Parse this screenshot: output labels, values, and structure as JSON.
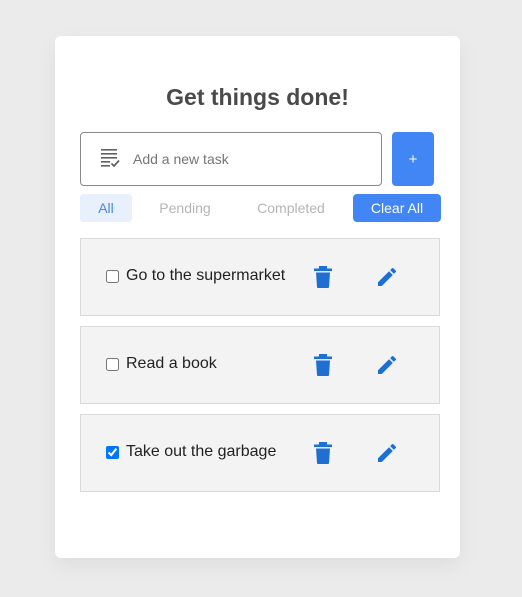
{
  "app": {
    "title": "Get things done!"
  },
  "input": {
    "placeholder": "Add a new task",
    "value": "",
    "icon": "task-list-icon",
    "add_label": "+"
  },
  "filters": {
    "all": "All",
    "pending": "Pending",
    "completed": "Completed",
    "active": "All",
    "clear_label": "Clear All"
  },
  "tasks": [
    {
      "label": "Go to the supermarket",
      "completed": false
    },
    {
      "label": "Read a book",
      "completed": false
    },
    {
      "label": "Take out the garbage",
      "completed": true
    }
  ],
  "icons": {
    "delete": "trash-icon",
    "edit": "pencil-icon"
  },
  "colors": {
    "accent": "#4285f4",
    "icon": "#1e6fd1",
    "active_filter_bg": "#e7f0fc",
    "task_bg": "#f3f3f3"
  }
}
